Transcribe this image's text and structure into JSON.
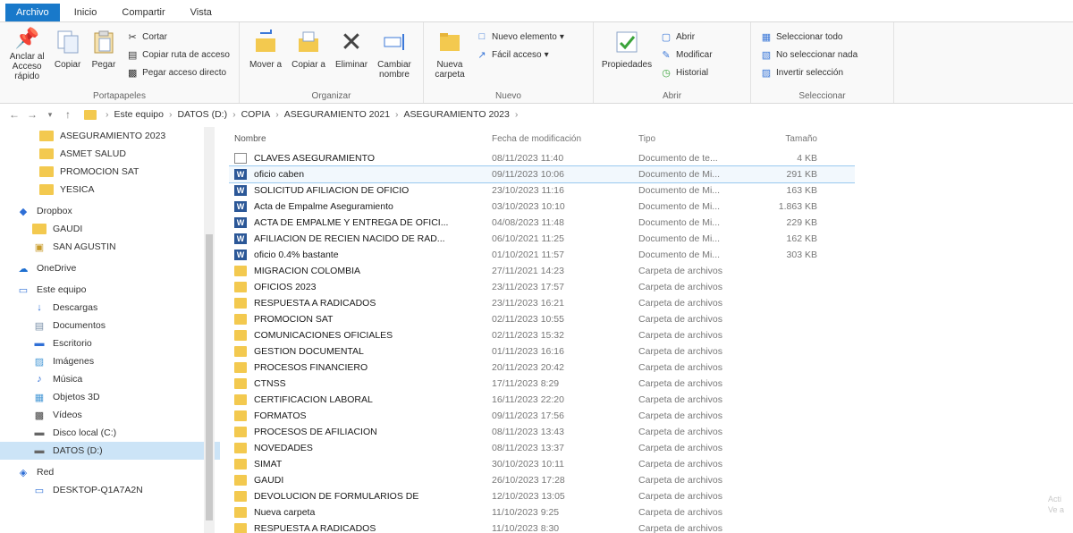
{
  "tabs": [
    "Archivo",
    "Inicio",
    "Compartir",
    "Vista"
  ],
  "ribbon": {
    "portapapeles": {
      "label": "Portapapeles",
      "anclar": "Anclar al Acceso rápido",
      "copiar": "Copiar",
      "pegar": "Pegar",
      "cortar": "Cortar",
      "copiar_ruta": "Copiar ruta de acceso",
      "pegar_acceso": "Pegar acceso directo"
    },
    "organizar": {
      "label": "Organizar",
      "mover": "Mover a",
      "copiar_a": "Copiar a",
      "eliminar": "Eliminar",
      "cambiar_nombre": "Cambiar nombre"
    },
    "nuevo": {
      "label": "Nuevo",
      "nueva_carpeta": "Nueva carpeta",
      "nuevo_elemento": "Nuevo elemento",
      "facil_acceso": "Fácil acceso"
    },
    "abrir": {
      "label": "Abrir",
      "propiedades": "Propiedades",
      "abrir": "Abrir",
      "modificar": "Modificar",
      "historial": "Historial"
    },
    "seleccionar": {
      "label": "Seleccionar",
      "todo": "Seleccionar todo",
      "nada": "No seleccionar nada",
      "invertir": "Invertir selección"
    }
  },
  "address": {
    "segments": [
      "Este equipo",
      "DATOS (D:)",
      "COPIA",
      "ASEGURAMIENTO 2021",
      "ASEGURAMIENTO 2023"
    ]
  },
  "nav": [
    {
      "label": "ASEGURAMIENTO 2023",
      "icon": "folder"
    },
    {
      "label": "ASMET SALUD",
      "icon": "folder"
    },
    {
      "label": "PROMOCION SAT",
      "icon": "folder"
    },
    {
      "label": "YESICA",
      "icon": "folder"
    },
    {
      "label": "Dropbox",
      "icon": "dropbox"
    },
    {
      "label": "GAUDI",
      "icon": "folder"
    },
    {
      "label": "SAN AGUSTIN",
      "icon": "folder-img"
    },
    {
      "label": "OneDrive",
      "icon": "cloud"
    },
    {
      "label": "Este equipo",
      "icon": "pc"
    },
    {
      "label": "Descargas",
      "icon": "download"
    },
    {
      "label": "Documentos",
      "icon": "doc"
    },
    {
      "label": "Escritorio",
      "icon": "desktop"
    },
    {
      "label": "Imágenes",
      "icon": "image"
    },
    {
      "label": "Música",
      "icon": "music"
    },
    {
      "label": "Objetos 3D",
      "icon": "cube"
    },
    {
      "label": "Vídeos",
      "icon": "video"
    },
    {
      "label": "Disco local (C:)",
      "icon": "drive"
    },
    {
      "label": "DATOS (D:)",
      "icon": "drive",
      "selected": true
    },
    {
      "label": "Red",
      "icon": "network"
    },
    {
      "label": "DESKTOP-Q1A7A2N",
      "icon": "pc"
    }
  ],
  "columns": {
    "name": "Nombre",
    "date": "Fecha de modificación",
    "type": "Tipo",
    "size": "Tamaño"
  },
  "files": [
    {
      "name": "CLAVES ASEGURAMIENTO",
      "date": "08/11/2023 11:40",
      "type": "Documento de te...",
      "size": "4 KB",
      "icon": "txt"
    },
    {
      "name": "oficio caben",
      "date": "09/11/2023 10:06",
      "type": "Documento de Mi...",
      "size": "291 KB",
      "icon": "word",
      "selected": true
    },
    {
      "name": "SOLICITUD AFILIACION DE OFICIO",
      "date": "23/10/2023 11:16",
      "type": "Documento de Mi...",
      "size": "163 KB",
      "icon": "word"
    },
    {
      "name": "Acta de Empalme Aseguramiento",
      "date": "03/10/2023 10:10",
      "type": "Documento de Mi...",
      "size": "1.863 KB",
      "icon": "word"
    },
    {
      "name": "ACTA DE EMPALME Y ENTREGA DE OFICI...",
      "date": "04/08/2023 11:48",
      "type": "Documento de Mi...",
      "size": "229 KB",
      "icon": "word"
    },
    {
      "name": "AFILIACION DE RECIEN NACIDO DE RAD...",
      "date": "06/10/2021 11:25",
      "type": "Documento de Mi...",
      "size": "162 KB",
      "icon": "word"
    },
    {
      "name": "oficio 0.4% bastante",
      "date": "01/10/2021 11:57",
      "type": "Documento de Mi...",
      "size": "303 KB",
      "icon": "word"
    },
    {
      "name": "MIGRACION COLOMBIA",
      "date": "27/11/2021 14:23",
      "type": "Carpeta de archivos",
      "size": "",
      "icon": "folder"
    },
    {
      "name": "OFICIOS 2023",
      "date": "23/11/2023 17:57",
      "type": "Carpeta de archivos",
      "size": "",
      "icon": "folder"
    },
    {
      "name": "RESPUESTA A RADICADOS",
      "date": "23/11/2023 16:21",
      "type": "Carpeta de archivos",
      "size": "",
      "icon": "folder"
    },
    {
      "name": "PROMOCION SAT",
      "date": "02/11/2023 10:55",
      "type": "Carpeta de archivos",
      "size": "",
      "icon": "folder"
    },
    {
      "name": "COMUNICACIONES OFICIALES",
      "date": "02/11/2023 15:32",
      "type": "Carpeta de archivos",
      "size": "",
      "icon": "folder"
    },
    {
      "name": "GESTION DOCUMENTAL",
      "date": "01/11/2023 16:16",
      "type": "Carpeta de archivos",
      "size": "",
      "icon": "folder"
    },
    {
      "name": "PROCESOS FINANCIERO",
      "date": "20/11/2023 20:42",
      "type": "Carpeta de archivos",
      "size": "",
      "icon": "folder"
    },
    {
      "name": "CTNSS",
      "date": "17/11/2023 8:29",
      "type": "Carpeta de archivos",
      "size": "",
      "icon": "folder"
    },
    {
      "name": "CERTIFICACION LABORAL",
      "date": "16/11/2023 22:20",
      "type": "Carpeta de archivos",
      "size": "",
      "icon": "folder"
    },
    {
      "name": "FORMATOS",
      "date": "09/11/2023 17:56",
      "type": "Carpeta de archivos",
      "size": "",
      "icon": "folder"
    },
    {
      "name": "PROCESOS DE AFILIACION",
      "date": "08/11/2023 13:43",
      "type": "Carpeta de archivos",
      "size": "",
      "icon": "folder"
    },
    {
      "name": "NOVEDADES",
      "date": "08/11/2023 13:37",
      "type": "Carpeta de archivos",
      "size": "",
      "icon": "folder"
    },
    {
      "name": "SIMAT",
      "date": "30/10/2023 10:11",
      "type": "Carpeta de archivos",
      "size": "",
      "icon": "folder"
    },
    {
      "name": "GAUDI",
      "date": "26/10/2023 17:28",
      "type": "Carpeta de archivos",
      "size": "",
      "icon": "folder"
    },
    {
      "name": "DEVOLUCION DE FORMULARIOS DE",
      "date": "12/10/2023 13:05",
      "type": "Carpeta de archivos",
      "size": "",
      "icon": "folder"
    },
    {
      "name": "Nueva carpeta",
      "date": "11/10/2023 9:25",
      "type": "Carpeta de archivos",
      "size": "",
      "icon": "folder"
    },
    {
      "name": "RESPUESTA A RADICADOS",
      "date": "11/10/2023 8:30",
      "type": "Carpeta de archivos",
      "size": "",
      "icon": "folder"
    }
  ],
  "watermark": [
    "Acti",
    "Ve a"
  ]
}
